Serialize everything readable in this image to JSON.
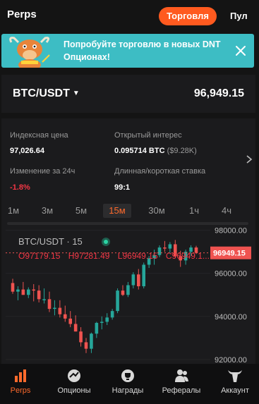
{
  "header": {
    "title": "Perps",
    "trade_button": "Торговля",
    "pool_label": "Пул"
  },
  "banner": {
    "text": "Попробуйте торговлю в новых DNT Опционах!"
  },
  "market": {
    "pair": "BTC/USDT",
    "price": "96,949.15"
  },
  "stats": {
    "index_price_label": "Индексная цена",
    "index_price_value": "97,026.64",
    "open_interest_label": "Открытый интерес",
    "open_interest_value": "0.095714 BTC",
    "open_interest_usd": "($9.28K)",
    "change_label": "Изменение за 24ч",
    "change_value": "-1.8%",
    "ratio_label": "Длинная/короткая ставка",
    "ratio_value": "99:1"
  },
  "timeframes": {
    "items": [
      "1м",
      "3м",
      "5м",
      "15м",
      "30м",
      "1ч",
      "4ч"
    ],
    "active": "15м"
  },
  "chart_data": {
    "type": "candlestick",
    "title": "BTC/USDT · 15",
    "ohlc_line": {
      "o": "O97179.15",
      "h": "H97281.49",
      "l": "L96949.15",
      "c": "C96949.1..."
    },
    "y_ticks": [
      "98000.00",
      "96000.00",
      "94000.00",
      "92000.00"
    ],
    "ylim": [
      91800,
      98150
    ],
    "current_price_label": "96949.15",
    "current_price": 96949.15,
    "colors": {
      "up": "#26a69a",
      "down": "#ef5350"
    },
    "candles": [
      {
        "o": 95550,
        "h": 95750,
        "l": 95050,
        "c": 95150
      },
      {
        "o": 95150,
        "h": 95400,
        "l": 94750,
        "c": 95250
      },
      {
        "o": 95250,
        "h": 95600,
        "l": 95000,
        "c": 95000
      },
      {
        "o": 95000,
        "h": 95350,
        "l": 94850,
        "c": 95250
      },
      {
        "o": 95250,
        "h": 95500,
        "l": 94700,
        "c": 95200
      },
      {
        "o": 95200,
        "h": 95450,
        "l": 94650,
        "c": 94800
      },
      {
        "o": 94800,
        "h": 95300,
        "l": 94600,
        "c": 94800
      },
      {
        "o": 94800,
        "h": 95150,
        "l": 94200,
        "c": 94350
      },
      {
        "o": 94350,
        "h": 94750,
        "l": 94050,
        "c": 94400
      },
      {
        "o": 94400,
        "h": 94750,
        "l": 93950,
        "c": 94100
      },
      {
        "o": 94100,
        "h": 94500,
        "l": 93750,
        "c": 93900
      },
      {
        "o": 93900,
        "h": 94250,
        "l": 93500,
        "c": 93650
      },
      {
        "o": 93650,
        "h": 94050,
        "l": 93300,
        "c": 93300
      },
      {
        "o": 93300,
        "h": 93500,
        "l": 92600,
        "c": 92800
      },
      {
        "o": 92800,
        "h": 93000,
        "l": 92300,
        "c": 92500
      },
      {
        "o": 92500,
        "h": 93250,
        "l": 92300,
        "c": 93200
      },
      {
        "o": 93200,
        "h": 93750,
        "l": 93000,
        "c": 93700
      },
      {
        "o": 93700,
        "h": 94000,
        "l": 93400,
        "c": 93750
      },
      {
        "o": 93750,
        "h": 94150,
        "l": 93600,
        "c": 93950
      },
      {
        "o": 93950,
        "h": 94350,
        "l": 93850,
        "c": 94250
      },
      {
        "o": 94250,
        "h": 95300,
        "l": 94150,
        "c": 95200
      },
      {
        "o": 95200,
        "h": 95450,
        "l": 94950,
        "c": 95000
      },
      {
        "o": 95000,
        "h": 95600,
        "l": 94900,
        "c": 95450
      },
      {
        "o": 95450,
        "h": 96050,
        "l": 95300,
        "c": 95950
      },
      {
        "o": 95950,
        "h": 96200,
        "l": 95250,
        "c": 95400
      },
      {
        "o": 95400,
        "h": 96500,
        "l": 95300,
        "c": 96400
      },
      {
        "o": 96400,
        "h": 96800,
        "l": 96250,
        "c": 96700
      },
      {
        "o": 96700,
        "h": 97100,
        "l": 96400,
        "c": 96850
      },
      {
        "o": 96850,
        "h": 97300,
        "l": 96750,
        "c": 97200
      },
      {
        "o": 97200,
        "h": 97500,
        "l": 97000,
        "c": 97150
      },
      {
        "o": 97150,
        "h": 97450,
        "l": 96950,
        "c": 97350
      },
      {
        "o": 97350,
        "h": 97550,
        "l": 96700,
        "c": 96800
      },
      {
        "o": 96800,
        "h": 97050,
        "l": 96300,
        "c": 96600
      },
      {
        "o": 96600,
        "h": 97100,
        "l": 96400,
        "c": 97000
      },
      {
        "o": 97000,
        "h": 97300,
        "l": 96800,
        "c": 97200
      },
      {
        "o": 97200,
        "h": 97280,
        "l": 96900,
        "c": 96949
      }
    ]
  },
  "nav": {
    "perps": "Perps",
    "options": "Опционы",
    "rewards": "Награды",
    "referrals": "Рефералы",
    "account": "Аккаунт"
  }
}
